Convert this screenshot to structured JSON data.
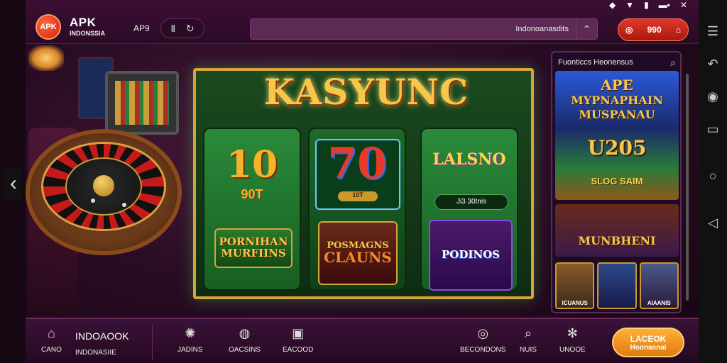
{
  "status_bar": {
    "icons": [
      "diamond-icon",
      "wifi-icon",
      "battery-icon",
      "signal-icon",
      "close-icon"
    ]
  },
  "header": {
    "logo_text": "APK",
    "brand_title": "APK",
    "brand_subtitle": "INDONSSIA",
    "apk_label": "AP9",
    "search_text": "Indonoanasdits",
    "wallet_amount": "990"
  },
  "main": {
    "title": "KASYUNC",
    "reels": [
      {
        "big": "10",
        "sub": "90T",
        "plate": "PORNIHAN MURFIINS"
      },
      {
        "big": "70",
        "pill": "10T",
        "plate_title": "POSMAGNS",
        "plate_big": "CLAUNS"
      },
      {
        "logo": "LALSNO",
        "info": "Ji3 30tnis",
        "plate": "PODINOS"
      }
    ]
  },
  "promo": {
    "header": "Fuonticcs Heonensus",
    "banners": [
      {
        "l1": "APE",
        "l2": "MYPNAPHAIN",
        "l3": "MUSPANAU",
        "l4": "U205",
        "l5": "SLOG SAIM"
      },
      {
        "l1": "MUNBHENI"
      }
    ],
    "tiles": [
      "ICUANUS",
      "",
      "AIAANIS"
    ]
  },
  "bottom_nav": {
    "home_title": "INDOAOOK",
    "home_sub": "INDONASIIE",
    "home_icon_label": "CANO",
    "items": [
      {
        "label": "JADINS",
        "icon": "sparkle-icon"
      },
      {
        "label": "OACSINS",
        "icon": "chips-icon"
      },
      {
        "label": "EACOOD",
        "icon": "phone-icon"
      },
      {
        "label": "BECONDONS",
        "icon": "target-icon"
      },
      {
        "label": "NUIS",
        "icon": "search-icon"
      },
      {
        "label": "UNOOE",
        "icon": "gear-icon"
      }
    ],
    "cta_line1": "LACEOK",
    "cta_line2": "Hoonasnai"
  },
  "colors": {
    "accent_gold": "#f6c84a",
    "brand_red": "#d41e10",
    "panel_purple": "#3a1238",
    "felt_green": "#1b4a1e",
    "cta_orange": "#ffb03a"
  }
}
